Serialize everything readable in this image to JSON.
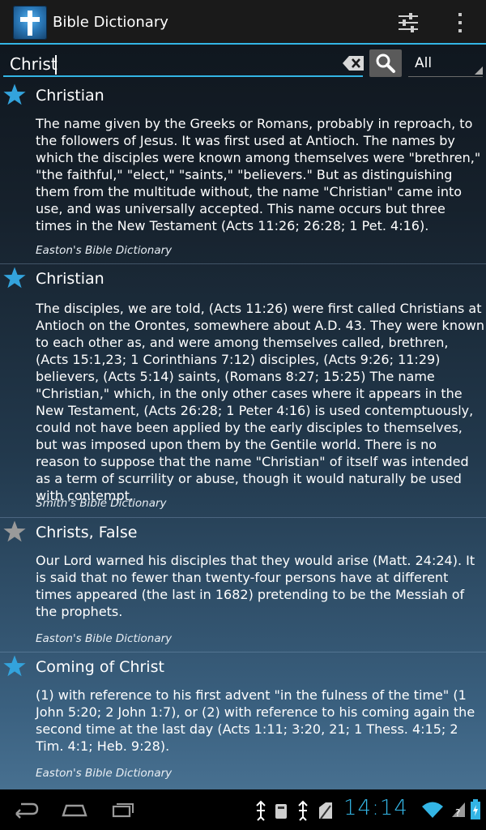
{
  "app": {
    "title": "Bible Dictionary"
  },
  "search": {
    "value": "Christ",
    "filter_selected": "All"
  },
  "entries": [
    {
      "title": "Christian",
      "starred": true,
      "body": "The name given by the Greeks or Romans, probably in reproach, to the followers of Jesus. It was first used at Antioch. The names by which the disciples were known among themselves were \"brethren,\" \"the faithful,\" \"elect,\" \"saints,\" \"believers.\" But as distinguishing them from the multitude without, the name \"Christian\" came into use, and was universally accepted. This name occurs but three times in the New Testament (Acts 11:26; 26:28; 1 Pet. 4:16).",
      "source": "Easton's Bible Dictionary"
    },
    {
      "title": "Christian",
      "starred": true,
      "body": "The disciples, we are told, (Acts 11:26) were first called Christians at Antioch on the Orontes, somewhere about A.D. 43. They were known to each other as, and were among themselves called, brethren, (Acts 15:1,23; 1 Corinthians 7:12) disciples, (Acts 9:26; 11:29) believers, (Acts 5:14) saints, (Romans 8:27; 15:25) The name \"Christian,\" which, in the only other cases where it appears in the New Testament, (Acts 26:28; 1 Peter 4:16) is used contemptuously, could not have been applied by the early disciples to themselves, but was imposed upon them by the Gentile world. There is no reason to suppose that the name \"Christian\" of itself was intended as a term of scurrility or abuse, though it would naturally be used with contempt.",
      "source": "Smith's Bible Dictionary"
    },
    {
      "title": "Christs, False",
      "starred": false,
      "body": "Our Lord warned his disciples that they would arise (Matt. 24:24). It is said that no fewer than twenty-four persons have at different times appeared (the last in 1682) pretending to be the Messiah of the prophets.",
      "source": "Easton's Bible Dictionary"
    },
    {
      "title": "Coming of Christ",
      "starred": true,
      "body": "(1) with reference to his first advent \"in the fulness of the time\" (1 John 5:20; 2 John 1:7), or (2) with reference to his coming again the second time at the last day (Acts 1:11; 3:20, 21; 1 Thess. 4:15; 2 Tim. 4:1; Heb. 9:28).",
      "source": "Easton's Bible Dictionary"
    }
  ],
  "status": {
    "time": "14:14"
  },
  "colors": {
    "accent": "#33b5e5",
    "star_on": "#33a3dc",
    "star_off": "#9a9a9a"
  }
}
